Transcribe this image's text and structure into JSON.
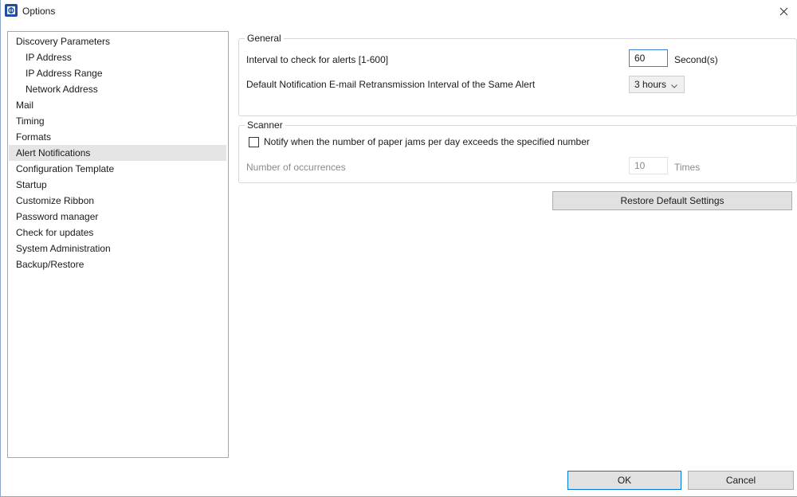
{
  "window": {
    "title": "Options"
  },
  "nav": {
    "items": [
      {
        "label": "Discovery Parameters",
        "level": 0,
        "selected": false
      },
      {
        "label": "IP Address",
        "level": 1,
        "selected": false
      },
      {
        "label": "IP Address Range",
        "level": 1,
        "selected": false
      },
      {
        "label": "Network Address",
        "level": 1,
        "selected": false
      },
      {
        "label": "Mail",
        "level": 0,
        "selected": false
      },
      {
        "label": "Timing",
        "level": 0,
        "selected": false
      },
      {
        "label": "Formats",
        "level": 0,
        "selected": false
      },
      {
        "label": "Alert Notifications",
        "level": 0,
        "selected": true
      },
      {
        "label": "Configuration Template",
        "level": 0,
        "selected": false
      },
      {
        "label": "Startup",
        "level": 0,
        "selected": false
      },
      {
        "label": "Customize Ribbon",
        "level": 0,
        "selected": false
      },
      {
        "label": "Password manager",
        "level": 0,
        "selected": false
      },
      {
        "label": "Check for updates",
        "level": 0,
        "selected": false
      },
      {
        "label": "System Administration",
        "level": 0,
        "selected": false
      },
      {
        "label": "Backup/Restore",
        "level": 0,
        "selected": false
      }
    ]
  },
  "general": {
    "legend": "General",
    "interval_label": "Interval to check for alerts [1-600]",
    "interval_value": "60",
    "interval_unit": "Second(s)",
    "retrans_label": "Default Notification E-mail Retransmission Interval of the Same Alert",
    "retrans_value": "3 hours"
  },
  "scanner": {
    "legend": "Scanner",
    "notify_label": "Notify when the number of paper jams per day exceeds the specified number",
    "notify_checked": false,
    "occurrences_label": "Number of occurrences",
    "occurrences_value": "10",
    "occurrences_unit": "Times"
  },
  "buttons": {
    "restore": "Restore Default Settings",
    "ok": "OK",
    "cancel": "Cancel"
  },
  "colors": {
    "accent": "#0078d7",
    "selected_bg": "#e5e5e5"
  }
}
